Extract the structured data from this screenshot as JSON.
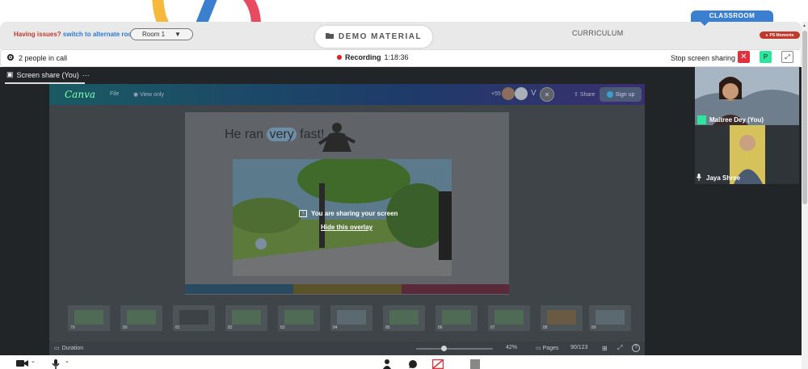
{
  "header": {
    "issues_text": "Having issues?",
    "alternate_link": "switch to alternate room",
    "room_value": "Room 1",
    "demo_label": "DEMO MATERIAL",
    "curriculum_label": "CURRICULUM",
    "classroom_tab": "CLASSROOM",
    "ps_moments": "PS Moments"
  },
  "call": {
    "people": "2 people in call",
    "recording_label": "Recording",
    "recording_time": "1:18:36",
    "stop_sharing": "Stop screen sharing",
    "p_button": "P"
  },
  "share": {
    "tab_label": "Screen share (You)",
    "overlay_text": "You are sharing your screen",
    "overlay_link": "Hide this overlay"
  },
  "canva": {
    "logo": "Canva",
    "file": "File",
    "view_only": "View only",
    "count": "+55",
    "v_label": "V",
    "share": "Share",
    "sign_up": "Sign up",
    "slide_title_pre": "He ran ",
    "slide_title_hl": "very",
    "slide_title_post": " fast!",
    "duration": "Duration",
    "zoom": "42%",
    "pages_label": "Pages",
    "page_count": "90/123",
    "thumb_numbers": [
      "79",
      "80",
      "81",
      "82",
      "83",
      "84",
      "85",
      "86",
      "87",
      "88",
      "89"
    ]
  },
  "participants": {
    "self_name": "Maitree Dey (You)",
    "other_name": "Jaya Shree"
  },
  "colors": {
    "accent_blue": "#3b7fd1",
    "record_red": "#e02020",
    "stop_red": "#e0303b",
    "green": "#2ee59d"
  }
}
